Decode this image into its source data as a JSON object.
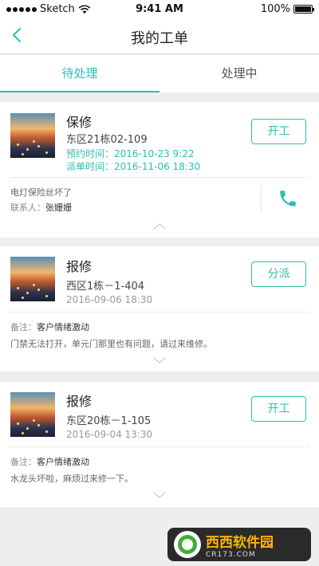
{
  "statusbar": {
    "carrier": "Sketch",
    "time": "9:41 AM",
    "battery": "100%"
  },
  "nav": {
    "title": "我的工单"
  },
  "tabs": [
    {
      "label": "待处理",
      "active": true
    },
    {
      "label": "处理中",
      "active": false
    }
  ],
  "orders": [
    {
      "title": "保修",
      "address": "东区21栋02-109",
      "line1": "预约时间：2016-10-23  9:22",
      "line2": "派单时间：2016-11-06 18:30",
      "action": "开工",
      "note1": "电灯保险丝坏了",
      "note2_label": "联系人：",
      "note2_value": "张姗姗"
    },
    {
      "title": "报修",
      "address": "西区1栋－1-404",
      "date": "2016-09-06 18:30",
      "action": "分派",
      "remark_label": "备注：",
      "remark_value": "客户情绪激动",
      "desc": "门禁无法打开，单元门那里也有问题，请过来维修。"
    },
    {
      "title": "报修",
      "address": "东区20栋－1-105",
      "date": "2016-09-04 13:30",
      "action": "开工",
      "remark_label": "备注：",
      "remark_value": "客户情绪激动",
      "desc": "水龙头坏啦，麻烦过来修一下。"
    }
  ],
  "watermark": {
    "name": "西西软件园",
    "domain": "CR173.COM"
  },
  "colors": {
    "accent": "#2bbfb0",
    "background": "#eeeeee"
  }
}
